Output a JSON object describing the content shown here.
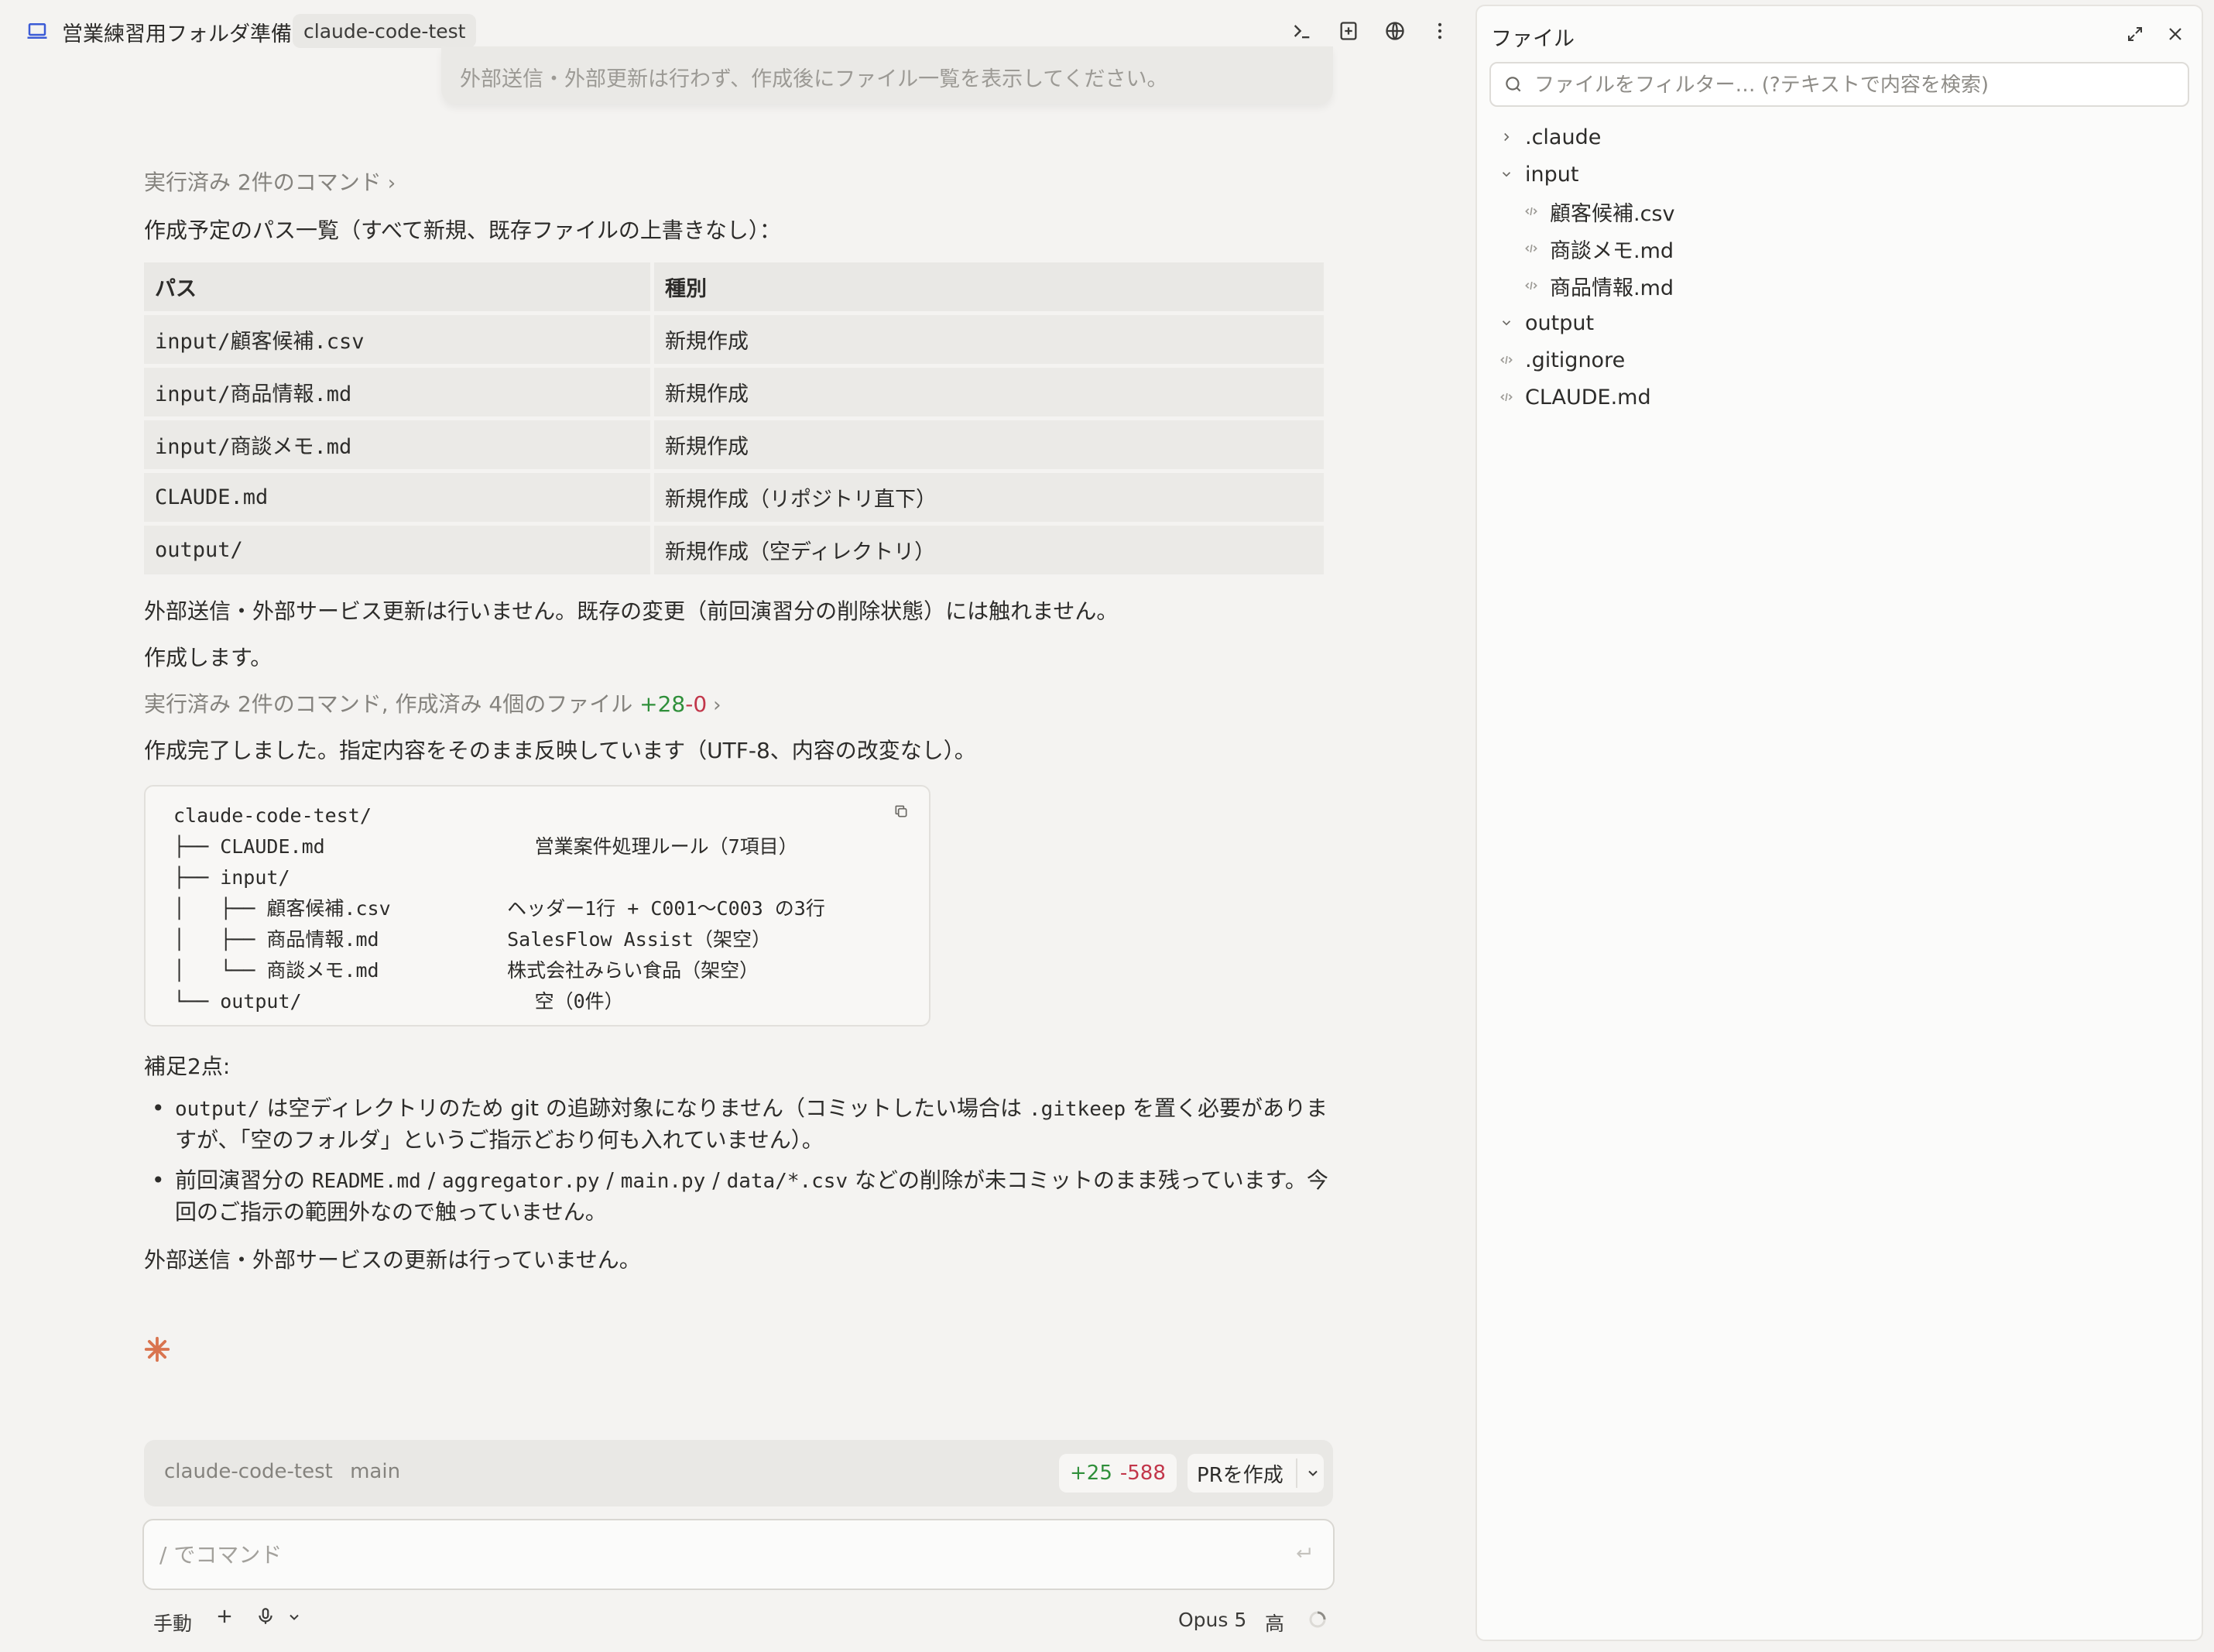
{
  "header": {
    "title": "営業練習用フォルダ準備",
    "repo_tag": "claude-code-test"
  },
  "chat": {
    "quoted_request": "外部送信・外部更新は行わず、作成後にファイル一覧を表示してください。",
    "executed_1": "実行済み 2件のコマンド",
    "intro": "作成予定のパス一覧（すべて新規、既存ファイルの上書きなし）：",
    "table": {
      "headers": [
        "パス",
        "種別"
      ],
      "rows": [
        [
          "input/顧客候補.csv",
          "新規作成"
        ],
        [
          "input/商品情報.md",
          "新規作成"
        ],
        [
          "input/商談メモ.md",
          "新規作成"
        ],
        [
          "CLAUDE.md",
          "新規作成（リポジトリ直下）"
        ],
        [
          "output/",
          "新規作成（空ディレクトリ）"
        ]
      ]
    },
    "no_external": "外部送信・外部サービス更新は行いません。既存の変更（前回演習分の削除状態）には触れません。",
    "will_create": "作成します。",
    "executed_2": "実行済み 2件のコマンド, 作成済み 4個のファイル",
    "executed_2_plus": "+28",
    "executed_2_minus": "-0",
    "done": "作成完了しました。指定内容をそのまま反映しています（UTF-8、内容の改変なし）。",
    "code_tree": "claude-code-test/\n├── CLAUDE.md                  営業案件処理ルール（7項目）\n├── input/\n│   ├── 顧客候補.csv          ヘッダー1行 + C001〜C003 の3行\n│   ├── 商品情報.md           SalesFlow Assist（架空）\n│   └── 商談メモ.md           株式会社みらい食品（架空）\n└── output/                    空（0件）",
    "supplement_title": "補足2点:",
    "note1": {
      "code1": "output/",
      "t1": " は空ディレクトリのため git の追跡対象になりません（コミットしたい場合は ",
      "code2": ".gitkeep",
      "t2": " を置く必要がありま",
      "line2": "すが、「空のフォルダ」というご指示どおり何も入れていません）。"
    },
    "note2": {
      "t0": "前回演習分の ",
      "c1": "README.md",
      "s1": " / ",
      "c2": "aggregator.py",
      "s2": " / ",
      "c3": "main.py",
      "s3": " / ",
      "c4": "data/*.csv",
      "t1": " などの削除が未コミットのまま残っています。今",
      "line2": "回のご指示の範囲外なので触っていません。"
    },
    "closing": "外部送信・外部サービスの更新は行っていません。"
  },
  "branch_bar": {
    "repo": "claude-code-test",
    "branch": "main",
    "plus": "+25",
    "minus": "-588",
    "pr_label": "PRを作成"
  },
  "input": {
    "placeholder": "/ でコマンド"
  },
  "footer": {
    "mode": "手動",
    "model": "Opus 5",
    "effort": "高"
  },
  "files_panel": {
    "title": "ファイル",
    "filter_placeholder": "ファイルをフィルター… (?テキストで内容を検索)",
    "tree": [
      {
        "name": ".claude",
        "type": "folder",
        "expanded": false,
        "depth": 0
      },
      {
        "name": "input",
        "type": "folder",
        "expanded": true,
        "depth": 0
      },
      {
        "name": "顧客候補.csv",
        "type": "file",
        "depth": 1
      },
      {
        "name": "商談メモ.md",
        "type": "file",
        "depth": 1
      },
      {
        "name": "商品情報.md",
        "type": "file",
        "depth": 1
      },
      {
        "name": "output",
        "type": "folder",
        "expanded": true,
        "depth": 0
      },
      {
        "name": ".gitignore",
        "type": "file",
        "depth": 0
      },
      {
        "name": "CLAUDE.md",
        "type": "file",
        "depth": 0
      }
    ]
  },
  "colors": {
    "accent_orange": "#d9744f",
    "plus_green": "#2f8f3a",
    "minus_red": "#c2364a"
  },
  "icons": [
    "laptop-icon",
    "terminal-icon",
    "add-panel-icon",
    "globe-icon",
    "more-icon",
    "expand-icon",
    "close-icon",
    "search-icon",
    "copy-icon",
    "spark-icon",
    "send-icon",
    "plus-icon",
    "mic-icon",
    "chevron-down-icon",
    "chevron-right-icon",
    "file-code-icon",
    "spinner-icon"
  ]
}
